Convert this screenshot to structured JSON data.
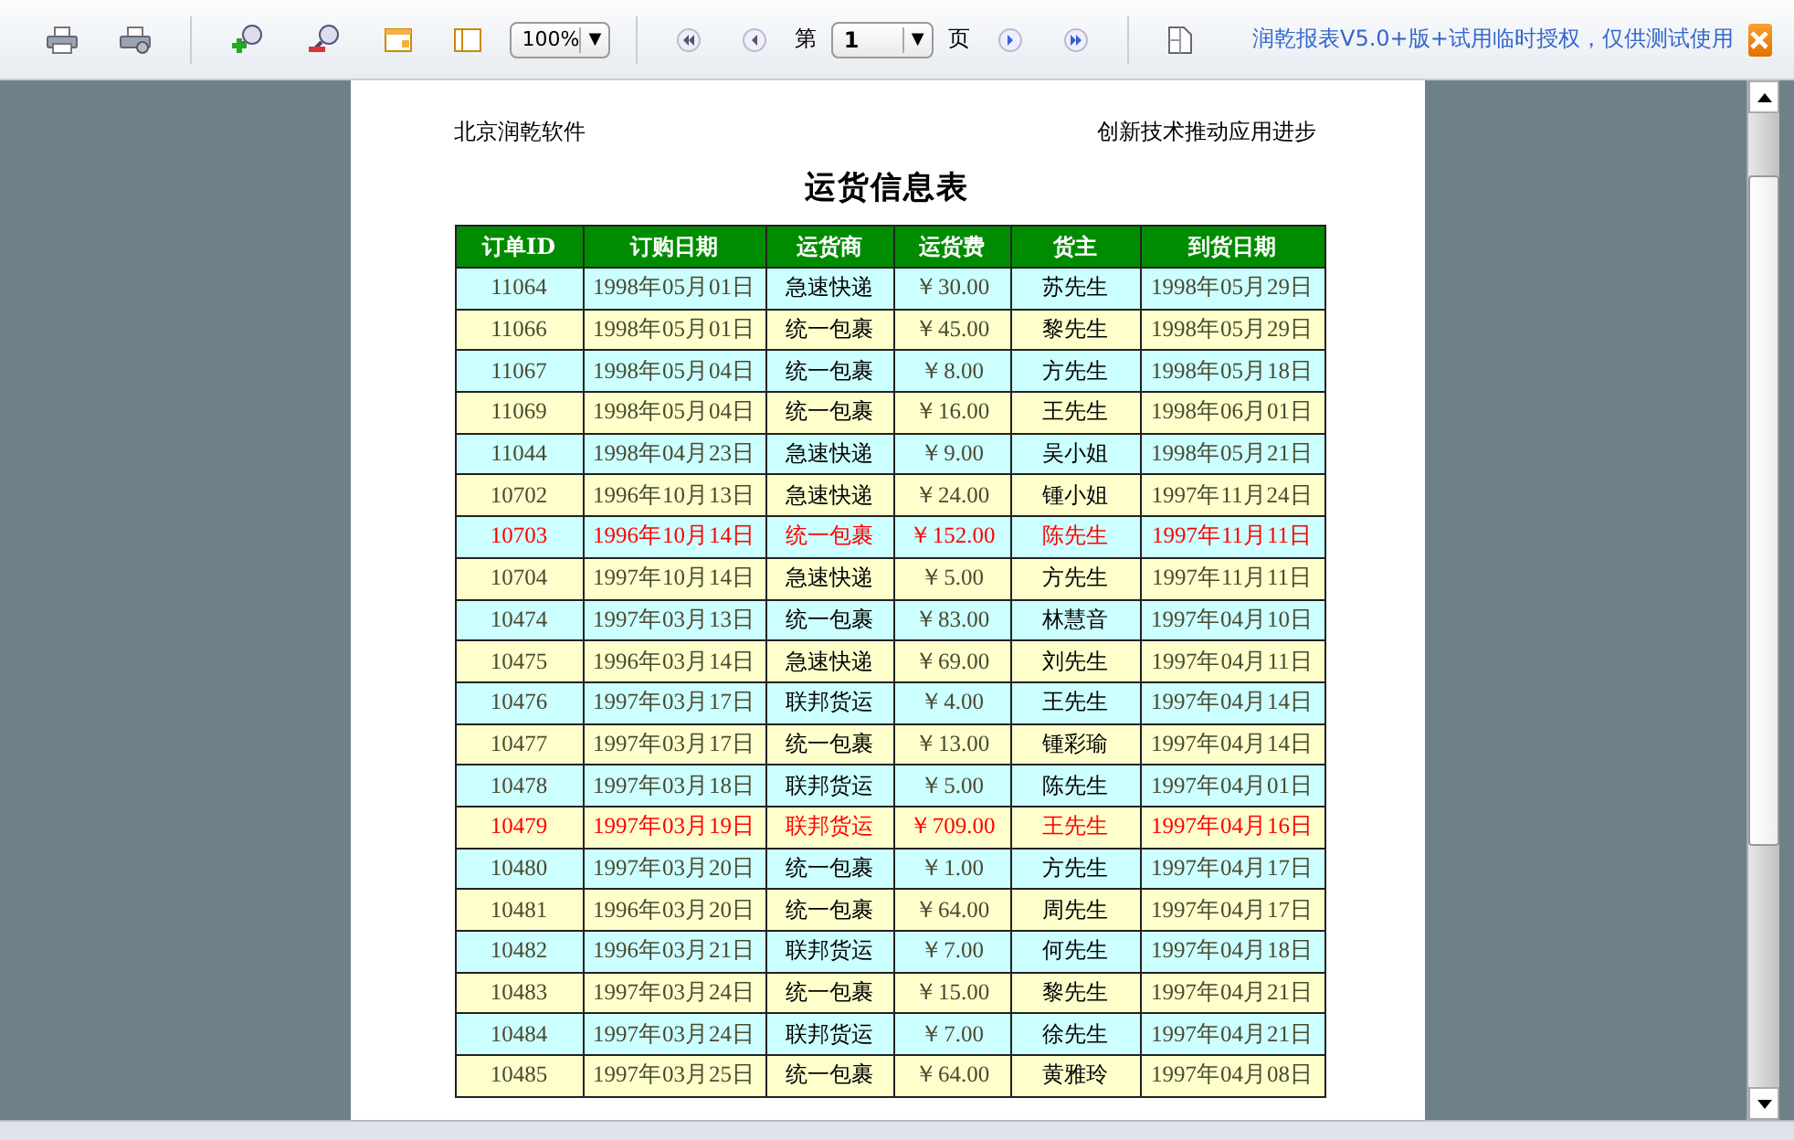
{
  "toolbar": {
    "dropdown_arrow": "▼",
    "zoom": "100%",
    "page_prefix": "第",
    "page": "1",
    "page_suffix": "页",
    "license_text": "润乾报表V5.0+版+试用临时授权，仅供测试使用"
  },
  "report": {
    "header_left": "北京润乾软件",
    "header_right": "创新技术推动应用进步",
    "title": "运货信息表",
    "columns": [
      "订单ID",
      "订购日期",
      "运货商",
      "运货费",
      "货主",
      "到货日期"
    ],
    "rows": [
      {
        "flagged": false,
        "cells": [
          "11064",
          "1998年05月01日",
          "急速快递",
          "￥30.00",
          "苏先生",
          "1998年05月29日"
        ]
      },
      {
        "flagged": false,
        "cells": [
          "11066",
          "1998年05月01日",
          "统一包裹",
          "￥45.00",
          "黎先生",
          "1998年05月29日"
        ]
      },
      {
        "flagged": false,
        "cells": [
          "11067",
          "1998年05月04日",
          "统一包裹",
          "￥8.00",
          "方先生",
          "1998年05月18日"
        ]
      },
      {
        "flagged": false,
        "cells": [
          "11069",
          "1998年05月04日",
          "统一包裹",
          "￥16.00",
          "王先生",
          "1998年06月01日"
        ]
      },
      {
        "flagged": false,
        "cells": [
          "11044",
          "1998年04月23日",
          "急速快递",
          "￥9.00",
          "吴小姐",
          "1998年05月21日"
        ]
      },
      {
        "flagged": false,
        "cells": [
          "10702",
          "1996年10月13日",
          "急速快递",
          "￥24.00",
          "锺小姐",
          "1997年11月24日"
        ]
      },
      {
        "flagged": true,
        "cells": [
          "10703",
          "1996年10月14日",
          "统一包裹",
          "￥152.00",
          "陈先生",
          "1997年11月11日"
        ]
      },
      {
        "flagged": false,
        "cells": [
          "10704",
          "1997年10月14日",
          "急速快递",
          "￥5.00",
          "方先生",
          "1997年11月11日"
        ]
      },
      {
        "flagged": false,
        "cells": [
          "10474",
          "1997年03月13日",
          "统一包裹",
          "￥83.00",
          "林慧音",
          "1997年04月10日"
        ]
      },
      {
        "flagged": false,
        "cells": [
          "10475",
          "1996年03月14日",
          "急速快递",
          "￥69.00",
          "刘先生",
          "1997年04月11日"
        ]
      },
      {
        "flagged": false,
        "cells": [
          "10476",
          "1997年03月17日",
          "联邦货运",
          "￥4.00",
          "王先生",
          "1997年04月14日"
        ]
      },
      {
        "flagged": false,
        "cells": [
          "10477",
          "1997年03月17日",
          "统一包裹",
          "￥13.00",
          "锺彩瑜",
          "1997年04月14日"
        ]
      },
      {
        "flagged": false,
        "cells": [
          "10478",
          "1997年03月18日",
          "联邦货运",
          "￥5.00",
          "陈先生",
          "1997年04月01日"
        ]
      },
      {
        "flagged": true,
        "cells": [
          "10479",
          "1997年03月19日",
          "联邦货运",
          "￥709.00",
          "王先生",
          "1997年04月16日"
        ]
      },
      {
        "flagged": false,
        "cells": [
          "10480",
          "1997年03月20日",
          "统一包裹",
          "￥1.00",
          "方先生",
          "1997年04月17日"
        ]
      },
      {
        "flagged": false,
        "cells": [
          "10481",
          "1996年03月20日",
          "统一包裹",
          "￥64.00",
          "周先生",
          "1997年04月17日"
        ]
      },
      {
        "flagged": false,
        "cells": [
          "10482",
          "1996年03月21日",
          "联邦货运",
          "￥7.00",
          "何先生",
          "1997年04月18日"
        ]
      },
      {
        "flagged": false,
        "cells": [
          "10483",
          "1997年03月24日",
          "统一包裹",
          "￥15.00",
          "黎先生",
          "1997年04月21日"
        ]
      },
      {
        "flagged": false,
        "cells": [
          "10484",
          "1997年03月24日",
          "联邦货运",
          "￥7.00",
          "徐先生",
          "1997年04月21日"
        ]
      },
      {
        "flagged": false,
        "cells": [
          "10485",
          "1997年03月25日",
          "统一包裹",
          "￥64.00",
          "黄雅玲",
          "1997年04月08日"
        ]
      }
    ]
  }
}
